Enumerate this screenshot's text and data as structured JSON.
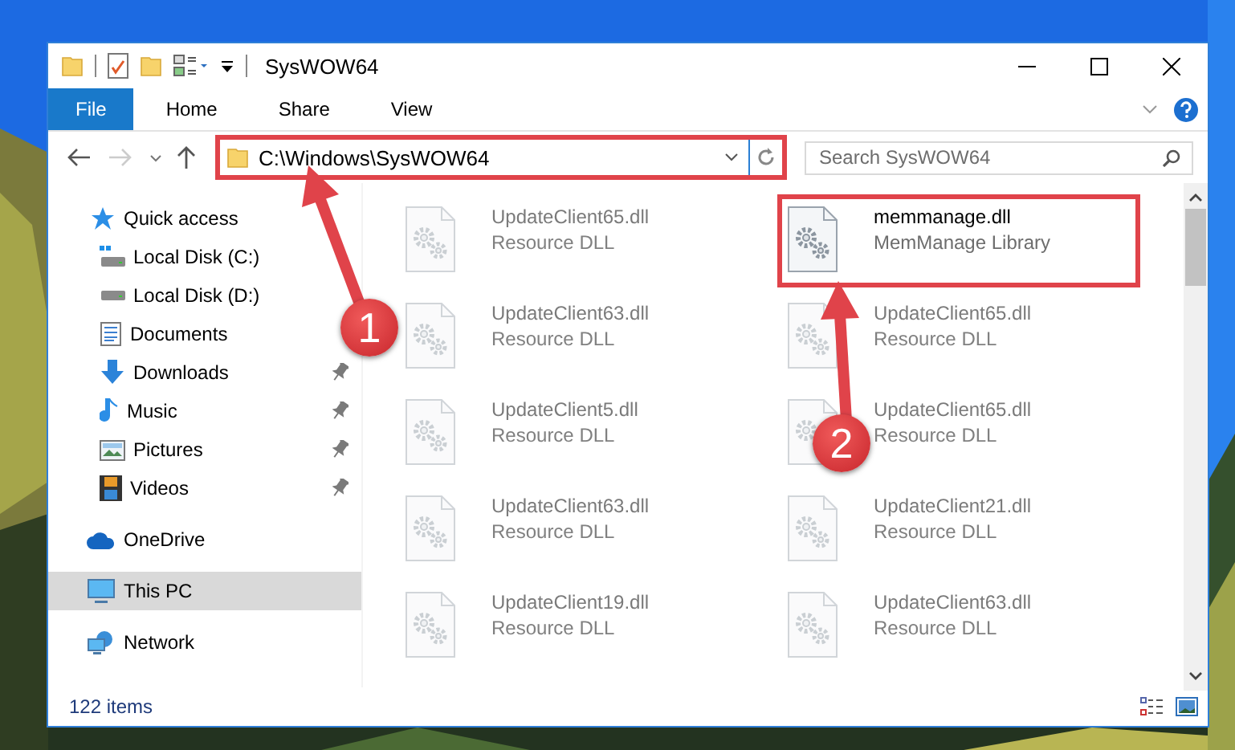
{
  "window": {
    "title": "SysWOW64"
  },
  "ribbon_tabs": [
    {
      "label": "File",
      "kind": "menu"
    },
    {
      "label": "Home",
      "kind": "tab"
    },
    {
      "label": "Share",
      "kind": "tab"
    },
    {
      "label": "View",
      "kind": "tab"
    }
  ],
  "address": {
    "path": "C:\\Windows\\SysWOW64",
    "highlighted": true
  },
  "search": {
    "placeholder": "Search SysWOW64"
  },
  "navigation": [
    {
      "label": "Quick access",
      "selected": false,
      "children": [
        {
          "label": "Local Disk (C:)",
          "pinned": false,
          "selected": false
        },
        {
          "label": "Local Disk (D:)",
          "pinned": false,
          "selected": false
        },
        {
          "label": "Documents",
          "pinned": false,
          "selected": false
        },
        {
          "label": "Downloads",
          "pinned": true,
          "selected": false
        },
        {
          "label": "Music",
          "pinned": true,
          "selected": false
        },
        {
          "label": "Pictures",
          "pinned": true,
          "selected": false
        },
        {
          "label": "Videos",
          "pinned": true,
          "selected": false
        }
      ]
    },
    {
      "label": "OneDrive",
      "selected": false
    },
    {
      "label": "This PC",
      "selected": true
    },
    {
      "label": "Network",
      "selected": false
    }
  ],
  "files": [
    {
      "name": "UpdateClient65.dll",
      "type": "Resource DLL",
      "blurred": true,
      "highlighted": false
    },
    {
      "name": "memmanage.dll",
      "type": "MemManage Library",
      "blurred": false,
      "highlighted": true
    },
    {
      "name": "UpdateClient63.dll",
      "type": "Resource DLL",
      "blurred": true,
      "highlighted": false
    },
    {
      "name": "UpdateClient65.dll",
      "type": "Resource DLL",
      "blurred": true,
      "highlighted": false
    },
    {
      "name": "UpdateClient5.dll",
      "type": "Resource DLL",
      "blurred": true,
      "highlighted": false
    },
    {
      "name": "UpdateClient65.dll",
      "type": "Resource DLL",
      "blurred": true,
      "highlighted": false
    },
    {
      "name": "UpdateClient63.dll",
      "type": "Resource DLL",
      "blurred": true,
      "highlighted": false
    },
    {
      "name": "UpdateClient21.dll",
      "type": "Resource DLL",
      "blurred": true,
      "highlighted": false
    },
    {
      "name": "UpdateClient19.dll",
      "type": "Resource DLL",
      "blurred": true,
      "highlighted": false
    },
    {
      "name": "UpdateClient63.dll",
      "type": "Resource DLL",
      "blurred": true,
      "highlighted": false
    }
  ],
  "status_bar": {
    "item_count": "122 items"
  },
  "callouts": [
    {
      "label": "1"
    },
    {
      "label": "2"
    }
  ]
}
